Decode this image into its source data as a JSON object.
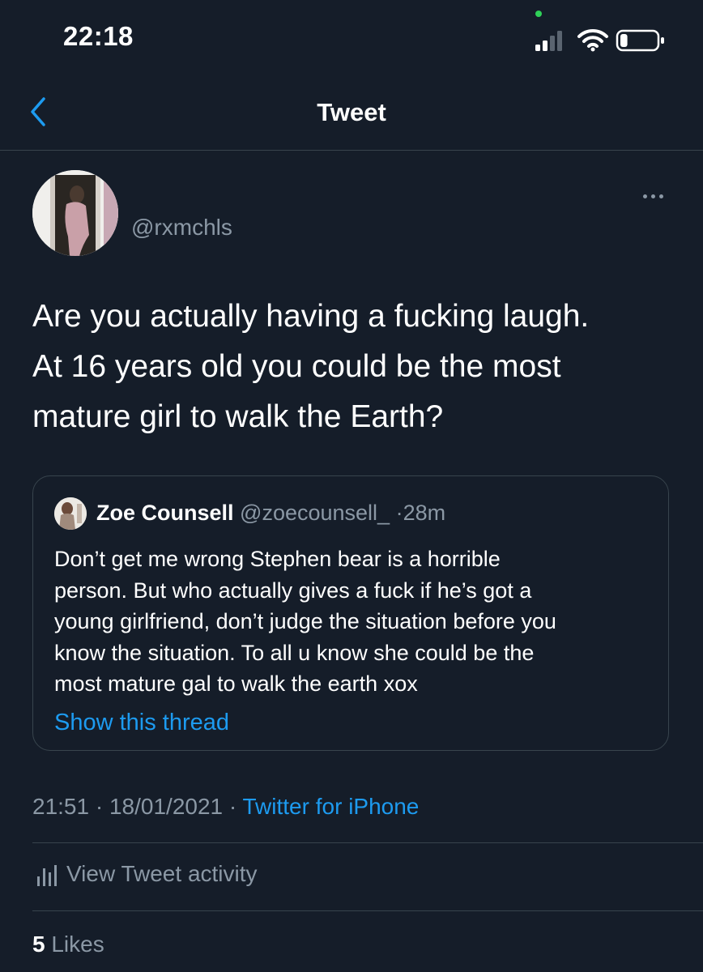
{
  "status_bar": {
    "time": "22:18",
    "signal_icon": "cellular-signal-icon",
    "wifi_icon": "wifi-icon",
    "battery_icon": "battery-icon",
    "battery_level": 0.2,
    "mic_indicator_color": "#2fd158"
  },
  "header": {
    "back_icon": "chevron-left-icon",
    "title": "Tweet"
  },
  "tweet": {
    "handle": "@rxmchls",
    "more_icon": "more-horizontal-icon",
    "lines": [
      "Are you actually having a fucking laugh.",
      "At 16 years old you could be the most",
      "mature girl to walk the Earth?"
    ],
    "quoted": {
      "name": "Zoe Counsell",
      "handle": "@zoecounsell_",
      "separator": "·",
      "time": "28m",
      "lines": [
        "Don’t get me wrong Stephen bear is a horrible",
        "person. But who actually gives a fuck if he’s got a",
        "young girlfriend, don’t judge the situation before you",
        "know the situation. To all u know she could be the",
        "most mature gal to walk the earth xox"
      ],
      "show_thread": "Show this thread"
    },
    "time": "21:51",
    "separator": "·",
    "date": "18/01/2021",
    "source": "Twitter for iPhone",
    "activity_icon": "bar-chart-icon",
    "activity_label": "View Tweet activity",
    "likes_count": "5",
    "likes_label": "Likes"
  },
  "colors": {
    "background": "#151d29",
    "text": "#ffffff",
    "secondary": "#8b98a5",
    "accent": "#1d9bf0",
    "border": "#38444d"
  }
}
